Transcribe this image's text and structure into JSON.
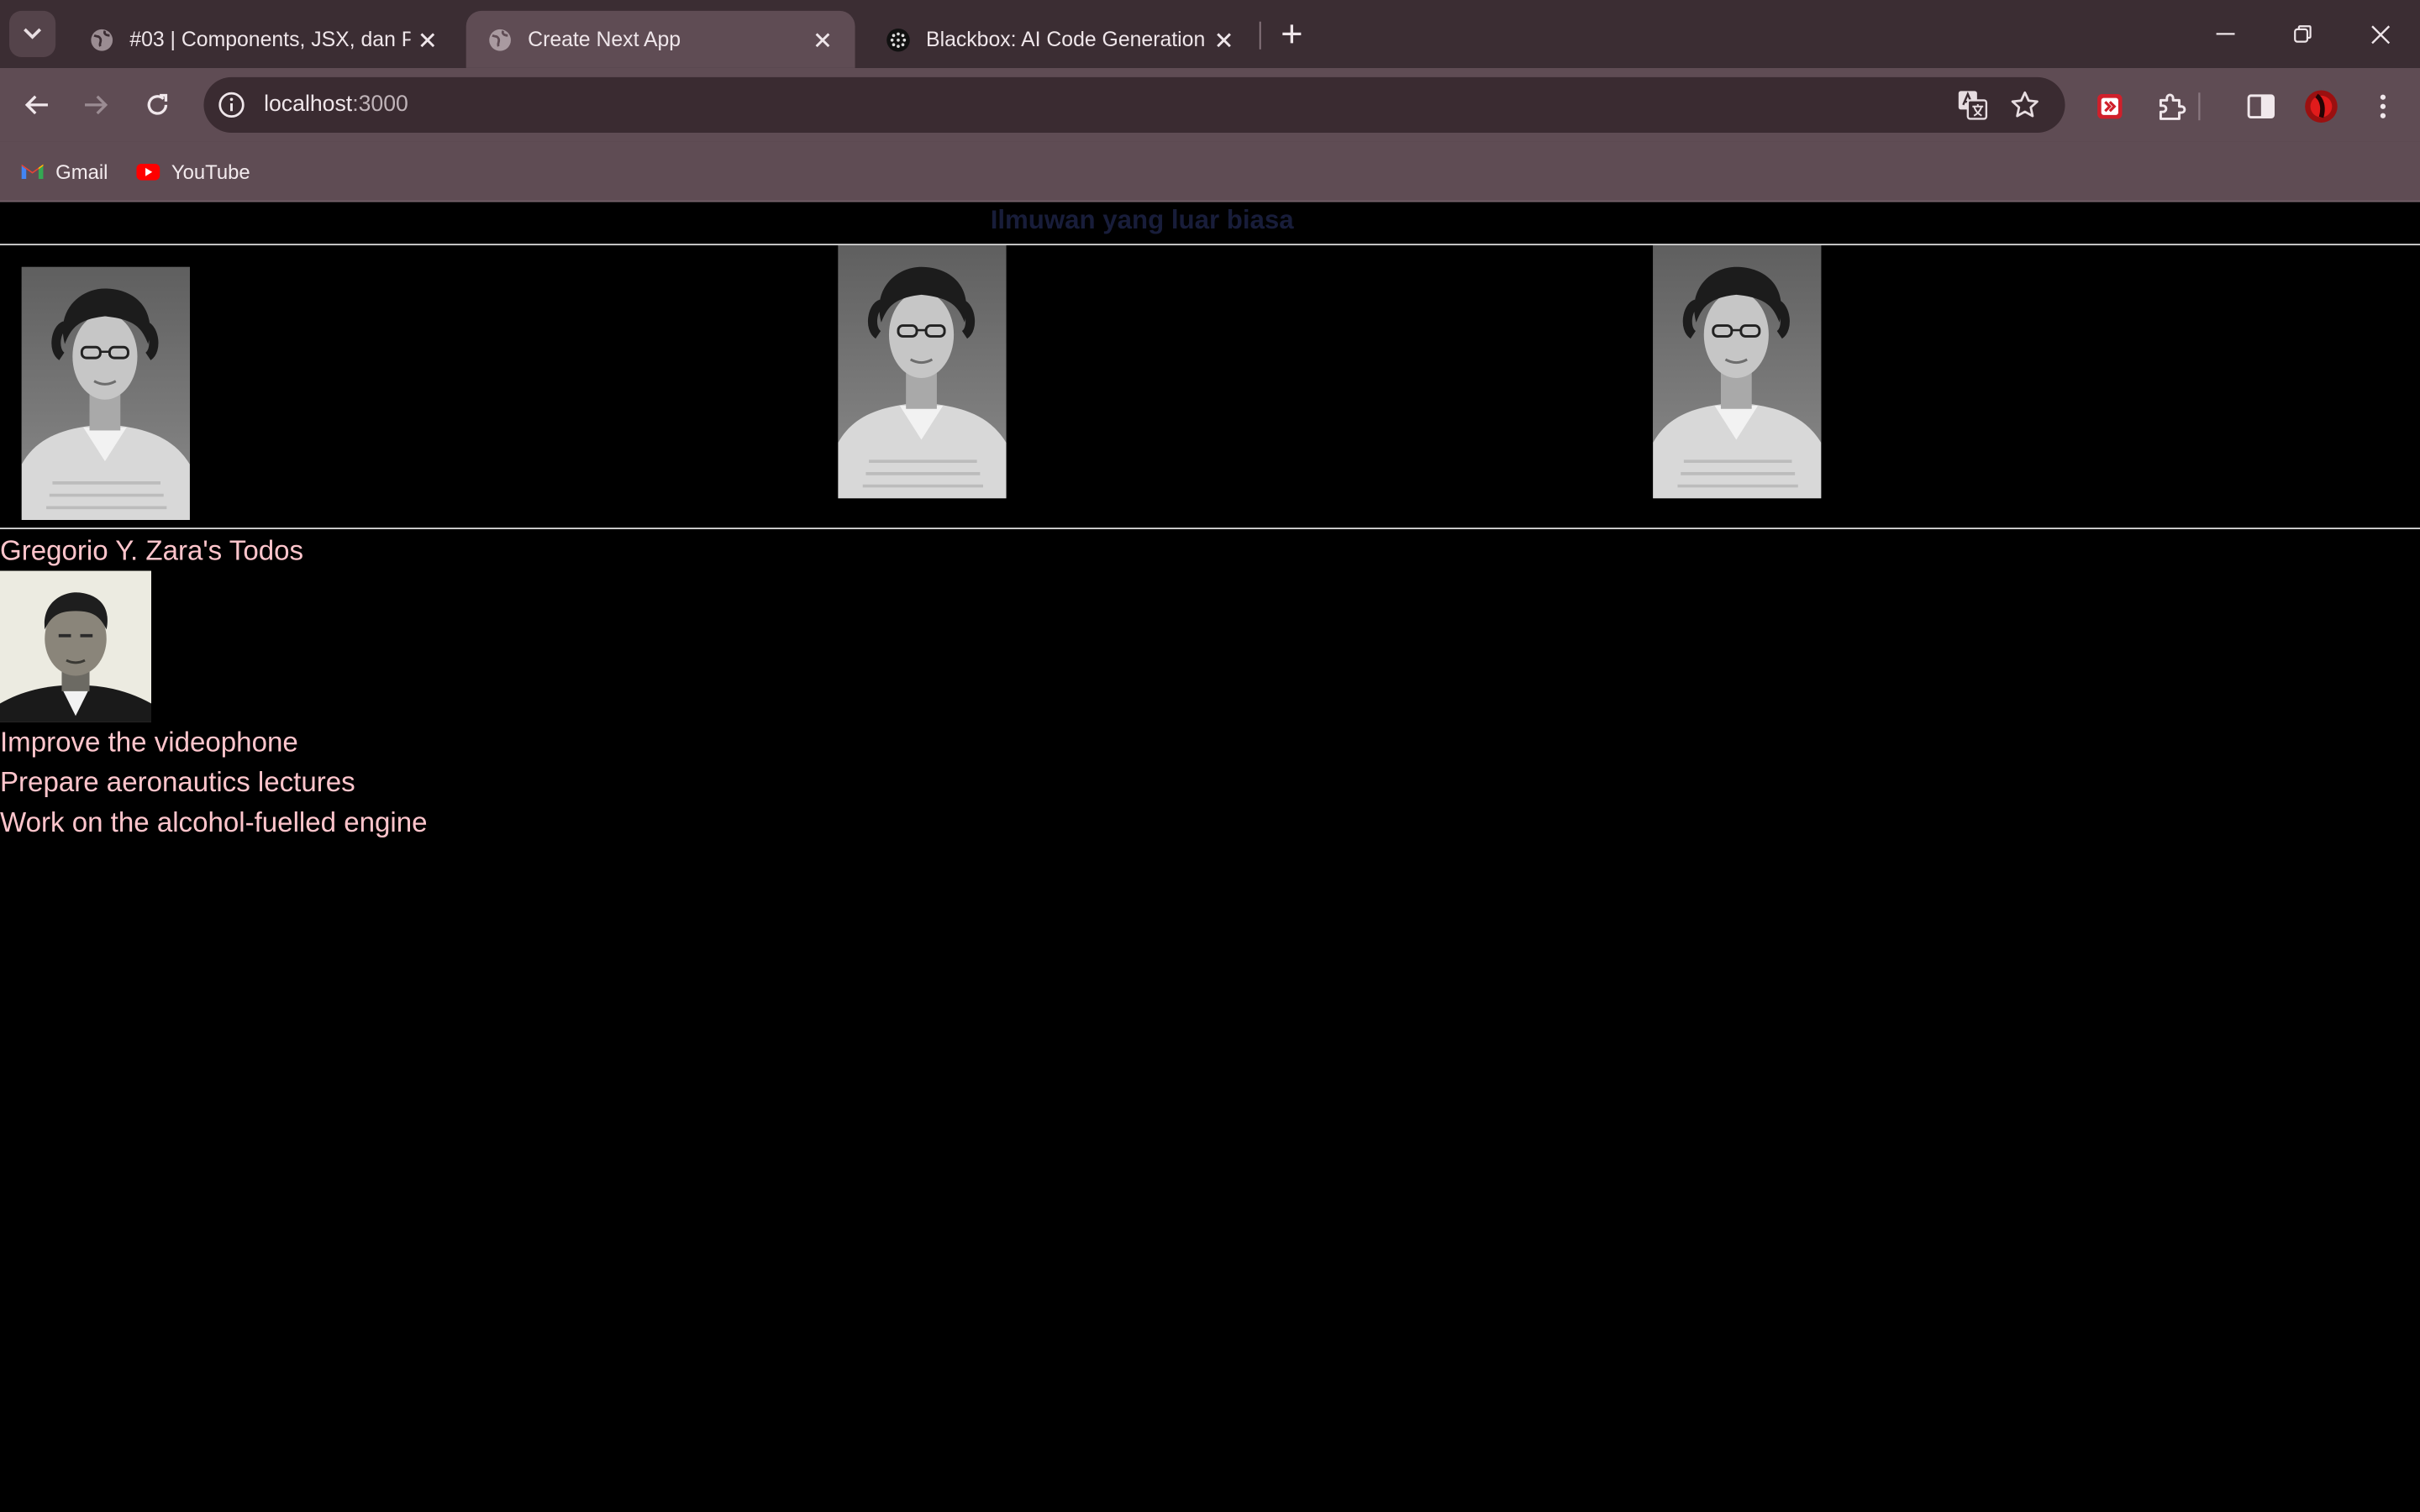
{
  "browser": {
    "tabs": [
      {
        "title": "#03 | Components, JSX, dan Pro",
        "favicon": "globe-icon",
        "active": false
      },
      {
        "title": "Create Next App",
        "favicon": "globe-icon",
        "active": true
      },
      {
        "title": "Blackbox: AI Code Generation, C",
        "favicon": "blackbox-icon",
        "active": false
      }
    ],
    "address": {
      "host": "localhost",
      "port": ":3000"
    },
    "bookmarks": [
      {
        "label": "Gmail",
        "icon": "gmail-icon"
      },
      {
        "label": "YouTube",
        "icon": "youtube-icon"
      }
    ],
    "colors": {
      "tabstrip": "#3b2d33",
      "toolbar": "#5f4c54",
      "omnibox": "#3a2b31"
    }
  },
  "page": {
    "heading": "Ilmuwan yang luar biasa",
    "gallery_alt": "Katherine Johnson",
    "todo_heading": "Gregorio Y. Zara's Todos",
    "person_alt": "Gregorio Y. Zara",
    "todos": [
      "Improve the videophone",
      "Prepare aeronautics lectures",
      "Work on the alcohol-fuelled engine"
    ],
    "colors": {
      "background": "#000000",
      "heading": "#181d3a",
      "todo_text": "#ffc5cc"
    }
  }
}
